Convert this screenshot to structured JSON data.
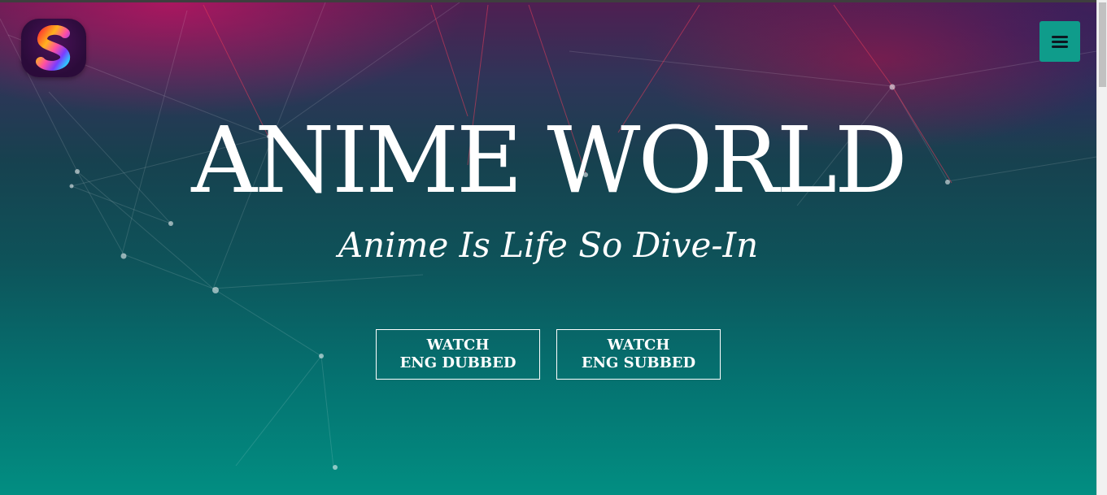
{
  "header": {
    "logo_icon": "s-logo-icon",
    "menu_icon": "hamburger-menu-icon",
    "accent_color": "#0f9c8b"
  },
  "hero": {
    "title": "ANIME WORLD",
    "tagline": "Anime Is Life So Dive-In",
    "buttons": [
      {
        "line1": "WATCH",
        "line2": "ENG DUBBED"
      },
      {
        "line1": "WATCH",
        "line2": "ENG SUBBED"
      }
    ],
    "background_colors": {
      "top": "#4f1f52",
      "middle": "#0e5259",
      "bottom": "#028e82",
      "highlight": "#c81464"
    }
  }
}
